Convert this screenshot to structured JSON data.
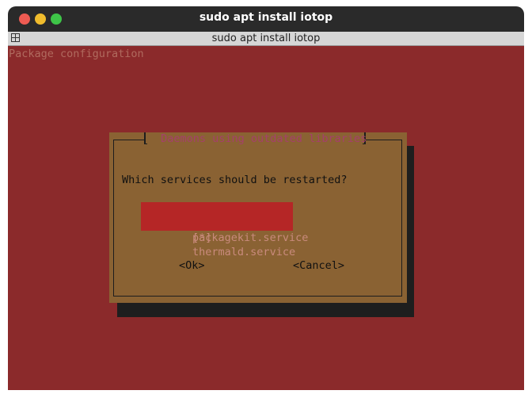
{
  "window": {
    "title": "sudo apt install iotop",
    "tab_title": "sudo apt install iotop"
  },
  "terminal": {
    "header_text": "Package configuration",
    "background": "#8b2a2b"
  },
  "dialog": {
    "title": "Daemons using outdated libraries",
    "question": "Which services should be restarted?",
    "services": [
      {
        "checkbox": "[*]",
        "label": "packagekit.service",
        "checked": true
      },
      {
        "checkbox": "[*]",
        "label": "thermald.service",
        "checked": true
      }
    ],
    "ok_label": "<Ok>",
    "cancel_label": "<Cancel>",
    "background": "#8a6233",
    "selection_color": "#b52626"
  },
  "icons": {
    "close": "close-icon",
    "minimize": "minimize-icon",
    "maximize": "maximize-icon",
    "tab": "grid-icon"
  }
}
